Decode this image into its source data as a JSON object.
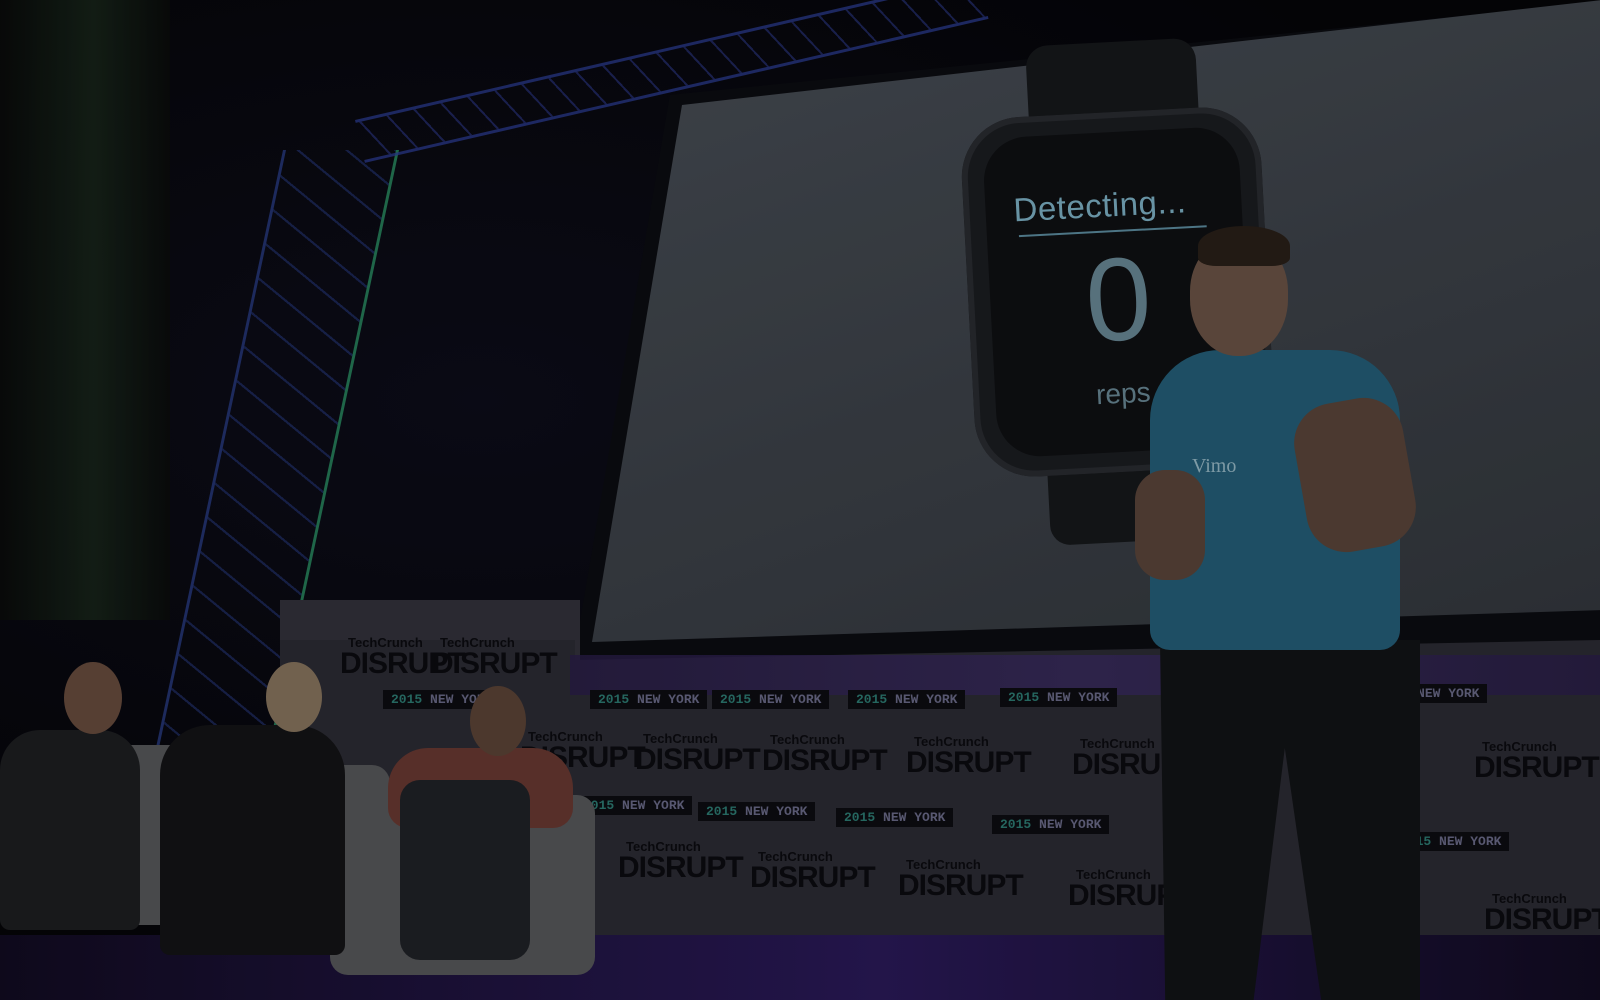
{
  "screen": {
    "status_text": "Detecting...",
    "rep_count": "0",
    "rep_unit": "reps"
  },
  "shirt": {
    "brand": "Vimo"
  },
  "branding": {
    "tc_label": "TechCrunch",
    "disrupt_label": "DISRUPT",
    "year_label": "2015",
    "city_label": "NEW YORK"
  },
  "colors": {
    "shirt": "#25607a",
    "watch_text": "#7fb4c9",
    "stage_floor": "#2b1a5a",
    "truss": "#2e3f9a"
  }
}
